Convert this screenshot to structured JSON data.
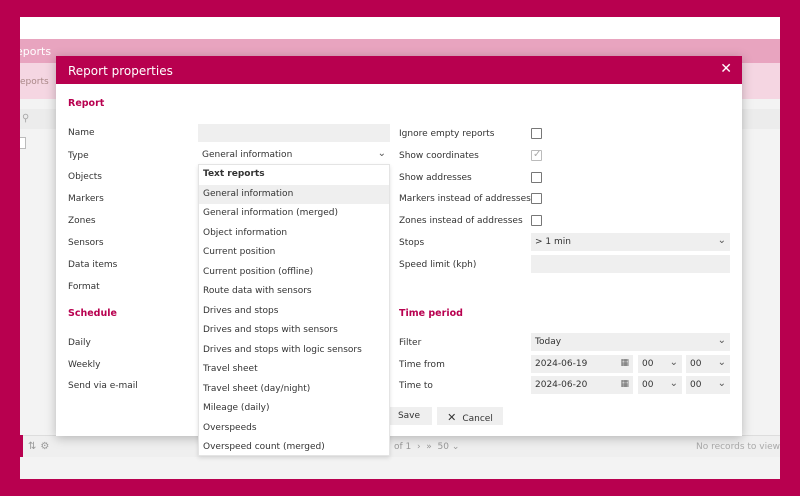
{
  "background": {
    "header_title": "eports",
    "sub_title": "eports",
    "search_icon": "search-icon",
    "footer_page": "of 1",
    "footer_page_size": "50",
    "footer_status": "No records to view"
  },
  "dialog": {
    "title": "Report properties",
    "close_label": "✕"
  },
  "report": {
    "section_title": "Report",
    "labels": {
      "name": "Name",
      "type": "Type",
      "objects": "Objects",
      "markers": "Markers",
      "zones": "Zones",
      "sensors": "Sensors",
      "data_items": "Data items",
      "format": "Format"
    },
    "name_value": "",
    "type_value": "General information"
  },
  "options": {
    "ignore_empty": {
      "label": "Ignore empty reports",
      "checked": false
    },
    "show_coordinates": {
      "label": "Show coordinates",
      "checked": true
    },
    "show_addresses": {
      "label": "Show addresses",
      "checked": false
    },
    "markers_instead": {
      "label": "Markers instead of addresses",
      "checked": false
    },
    "zones_instead": {
      "label": "Zones instead of addresses",
      "checked": false
    },
    "stops_label": "Stops",
    "stops_value": "> 1 min",
    "speed_limit_label": "Speed limit (kph)",
    "speed_limit_value": ""
  },
  "schedule": {
    "section_title": "Schedule",
    "daily": "Daily",
    "weekly": "Weekly",
    "send_email": "Send via e-mail"
  },
  "time_period": {
    "section_title": "Time period",
    "filter_label": "Filter",
    "filter_value": "Today",
    "time_from_label": "Time from",
    "time_from_date": "2024-06-19",
    "time_from_hour": "00",
    "time_from_minute": "00",
    "time_to_label": "Time to",
    "time_to_date": "2024-06-20",
    "time_to_hour": "00",
    "time_to_minute": "00"
  },
  "buttons": {
    "save": "Save",
    "cancel": "Cancel"
  },
  "type_dropdown": {
    "group_label": "Text reports",
    "items": [
      "General information",
      "General information (merged)",
      "Object information",
      "Current position",
      "Current position (offline)",
      "Route data with sensors",
      "Drives and stops",
      "Drives and stops with sensors",
      "Drives and stops with logic sensors",
      "Travel sheet",
      "Travel sheet (day/night)",
      "Mileage (daily)",
      "Overspeeds",
      "Overspeed count (merged)"
    ],
    "selected_index": 0
  },
  "colors": {
    "brand": "#b8004f",
    "field_bg": "#efefef"
  }
}
